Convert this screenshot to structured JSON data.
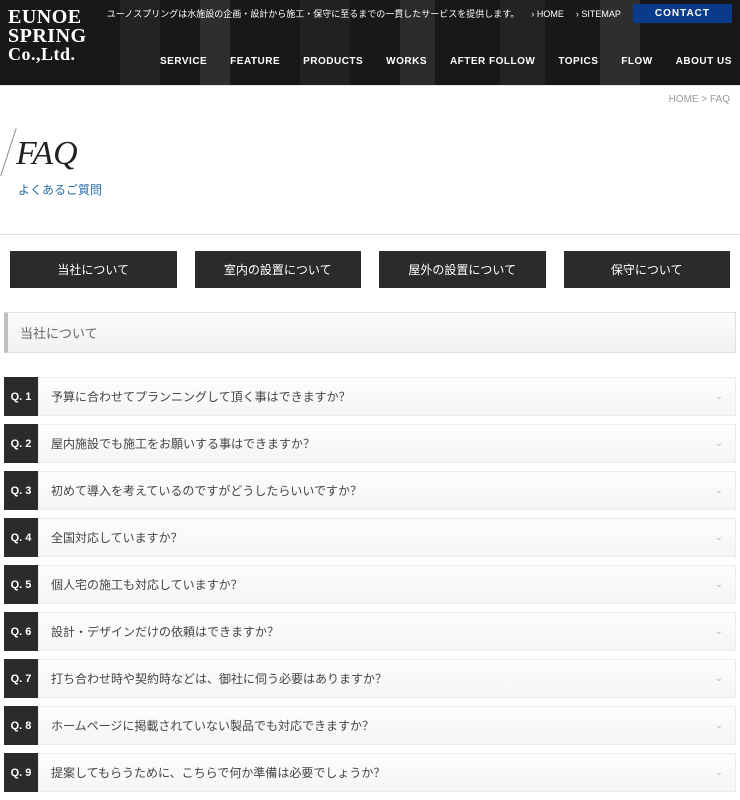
{
  "header": {
    "logo": {
      "l1": "EUNOE",
      "l2": "SPRING",
      "l3": "Co.,Ltd."
    },
    "tagline": "ユーノスプリングは水施設の企画・設計から施工・保守に至るまでの一貫したサービスを提供します。",
    "links": {
      "home": "HOME",
      "sitemap": "SITEMAP"
    },
    "contact": "CONTACT",
    "nav": [
      "SERVICE",
      "FEATURE",
      "PRODUCTS",
      "WORKS",
      "AFTER FOLLOW",
      "TOPICS",
      "FLOW",
      "ABOUT US"
    ]
  },
  "breadcrumb": {
    "home": "HOME",
    "sep": " > ",
    "current": "FAQ"
  },
  "page": {
    "title": "FAQ",
    "subtitle": "よくあるご質問"
  },
  "tabs": [
    "当社について",
    "室内の設置について",
    "屋外の設置について",
    "保守について"
  ],
  "section": {
    "heading": "当社について"
  },
  "faq": [
    {
      "num": "Q. 1",
      "text": "予算に合わせてプランニングして頂く事はできますか？"
    },
    {
      "num": "Q. 2",
      "text": "屋内施設でも施工をお願いする事はできますか？"
    },
    {
      "num": "Q. 3",
      "text": "初めて導入を考えているのですがどうしたらいいですか？"
    },
    {
      "num": "Q. 4",
      "text": "全国対応していますか？"
    },
    {
      "num": "Q. 5",
      "text": "個人宅の施工も対応していますか？"
    },
    {
      "num": "Q. 6",
      "text": "設計・デザインだけの依頼はできますか？"
    },
    {
      "num": "Q. 7",
      "text": "打ち合わせ時や契約時などは、御社に伺う必要はありますか？"
    },
    {
      "num": "Q. 8",
      "text": "ホームページに掲載されていない製品でも対応できますか？"
    },
    {
      "num": "Q. 9",
      "text": "提案してもらうために、こちらで何か準備は必要でしょうか？"
    }
  ]
}
